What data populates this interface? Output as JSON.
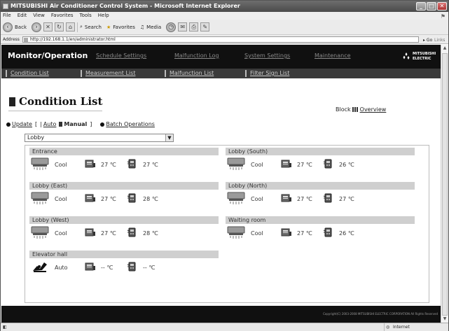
{
  "window": {
    "title": "MITSUBISHI Air Conditioner Control System - Microsoft Internet Explorer"
  },
  "menu": [
    "File",
    "Edit",
    "View",
    "Favorites",
    "Tools",
    "Help"
  ],
  "toolbar": {
    "back": "Back",
    "search": "Search",
    "favorites": "Favorites",
    "media": "Media"
  },
  "address": {
    "label": "Address",
    "url": "http://192.168.1.1/en/administrator.html",
    "go": "Go",
    "links": "Links"
  },
  "header": {
    "brand": "Monitor/Operation",
    "nav": [
      "Schedule Settings",
      "Malfunction Log",
      "System Settings",
      "Maintenance"
    ],
    "logo": "MITSUBISHI ELECTRIC"
  },
  "subnav": [
    "Condition List",
    "Measurement List",
    "Malfunction List",
    "Filter Sign List"
  ],
  "page": {
    "title": "Condition List",
    "block_label": "Block",
    "overview": "Overview"
  },
  "actions": {
    "update": "Update",
    "auto": "Auto",
    "manual": "Manual",
    "open_bracket": "[",
    "sep": "|",
    "close_bracket": "]",
    "batch": "Batch Operations"
  },
  "select": {
    "value": "Lobby"
  },
  "groups": [
    {
      "name": "Entrance",
      "mode": "Cool",
      "set_temp": "27 ℃",
      "room_temp": "27 ℃",
      "icon": "ac-cool-icon"
    },
    {
      "name": "Lobby (South)",
      "mode": "Cool",
      "set_temp": "27 ℃",
      "room_temp": "26 ℃",
      "icon": "ac-cool-icon"
    },
    {
      "name": "Lobby (East)",
      "mode": "Cool",
      "set_temp": "27 ℃",
      "room_temp": "28 ℃",
      "icon": "ac-cool-icon"
    },
    {
      "name": "Lobby (North)",
      "mode": "Cool",
      "set_temp": "27 ℃",
      "room_temp": "27 ℃",
      "icon": "ac-cool-icon"
    },
    {
      "name": "Lobby (West)",
      "mode": "Cool",
      "set_temp": "27 ℃",
      "room_temp": "28 ℃",
      "icon": "ac-cool-icon"
    },
    {
      "name": "Waiting room",
      "mode": "Cool",
      "set_temp": "27 ℃",
      "room_temp": "26 ℃",
      "icon": "ac-cool-icon"
    },
    {
      "name": "Elevator hall",
      "mode": "Auto",
      "set_temp": "-- ℃",
      "room_temp": "-- ℃",
      "icon": "fan-auto-icon"
    }
  ],
  "footer": {
    "copyright": "Copyright(C) 2003-2008 MITSUBISHI ELECTRIC CORPORATION All Rights Reserved"
  },
  "status": {
    "zone": "Internet"
  }
}
